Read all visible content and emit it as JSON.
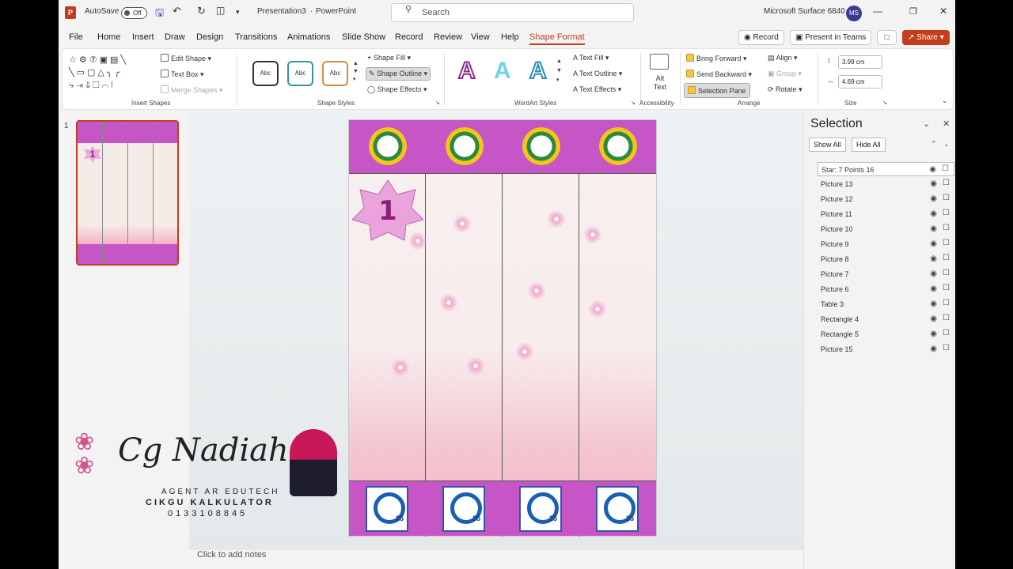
{
  "titlebar": {
    "autosave_label": "AutoSave",
    "autosave_state": "Off",
    "doc_title": "Presentation3",
    "app_name": "PowerPoint",
    "search_placeholder": "Search",
    "device": "Microsoft Surface 6840",
    "user_initials": "MS"
  },
  "menu": [
    "File",
    "Home",
    "Insert",
    "Draw",
    "Design",
    "Transitions",
    "Animations",
    "Slide Show",
    "Record",
    "Review",
    "View",
    "Help",
    "Shape Format"
  ],
  "top_buttons": {
    "record": "Record",
    "present": "Present in Teams",
    "share": "Share"
  },
  "ribbon": {
    "insert_shapes": {
      "label": "Insert Shapes",
      "edit_shape": "Edit Shape",
      "text_box": "Text Box",
      "merge_shapes": "Merge Shapes"
    },
    "shape_styles": {
      "label": "Shape Styles",
      "sample": "Abc",
      "fill": "Shape Fill",
      "outline": "Shape Outline",
      "effects": "Shape Effects"
    },
    "wordart": {
      "label": "WordArt Styles",
      "glyph": "A",
      "text_fill": "Text Fill",
      "text_outline": "Text Outline",
      "text_effects": "Text Effects"
    },
    "accessibility": {
      "label": "Accessibility",
      "alt_text": "Alt Text"
    },
    "arrange": {
      "label": "Arrange",
      "bring_forward": "Bring Forward",
      "send_backward": "Send Backward",
      "selection_pane": "Selection Pane",
      "align": "Align",
      "group": "Group",
      "rotate": "Rotate"
    },
    "size": {
      "label": "Size",
      "height": "3.99 cm",
      "width": "4.69 cm"
    }
  },
  "slide_number": "1",
  "slide": {
    "star_number": "1"
  },
  "notes_placeholder": "Click to add notes",
  "watermark": {
    "script_name": "Cg Nadiah",
    "line1": "AGENT AR EDUTECH",
    "line2": "CIKGU KALKULATOR",
    "line3": "0133108845"
  },
  "selection_pane": {
    "title": "Selection",
    "show_all": "Show All",
    "hide_all": "Hide All",
    "items": [
      "Star: 7 Points 16",
      "Picture 13",
      "Picture 12",
      "Picture 11",
      "Picture 10",
      "Picture 9",
      "Picture 8",
      "Picture 7",
      "Picture 6",
      "Table 3",
      "Rectangle 4",
      "Rectangle 5",
      "Picture 15"
    ]
  },
  "colors": {
    "accent": "#c43e1c",
    "slide_band": "#c656c6"
  }
}
